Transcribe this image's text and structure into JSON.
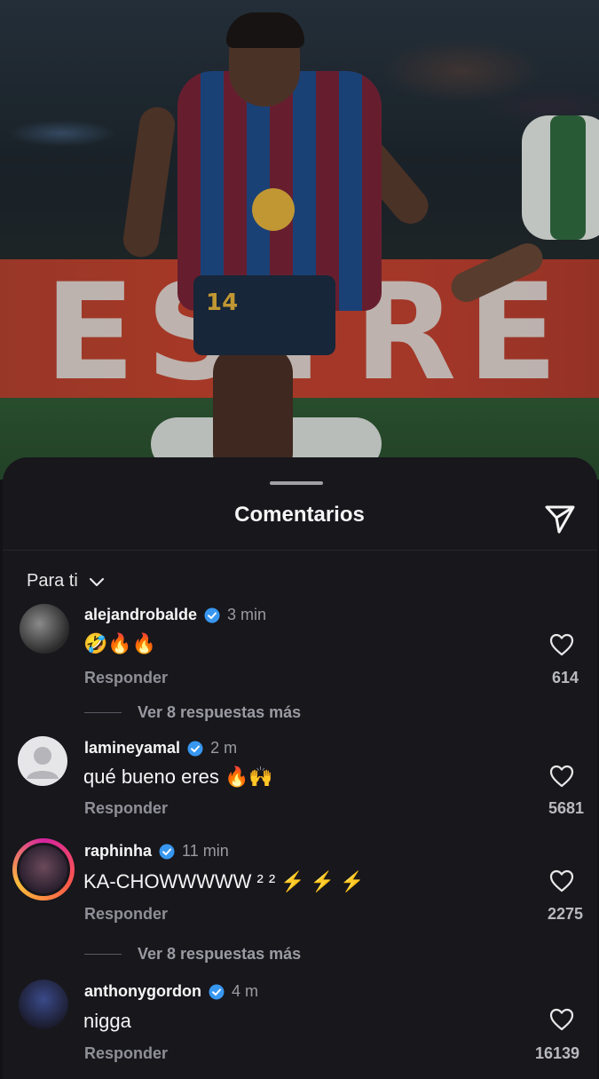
{
  "photo": {
    "banner_text": "ESTRE",
    "jersey_number": "14"
  },
  "sheet": {
    "title": "Comentarios",
    "filter_label": "Para ti"
  },
  "comments": [
    {
      "username": "alejandrobalde",
      "time": "3 min",
      "text": "🤣🔥🔥",
      "reply": "Responder",
      "likes": "614",
      "more_replies": "Ver 8 respuestas más"
    },
    {
      "username": "lamineyamal",
      "time": "2 m",
      "text": "qué bueno eres 🔥🙌",
      "reply": "Responder",
      "likes": "5681"
    },
    {
      "username": "raphinha",
      "time": "11 min",
      "text": "KA-CHOWWWWW ² ² ⚡ ⚡ ⚡",
      "reply": "Responder",
      "likes": "2275",
      "more_replies": "Ver 8 respuestas más"
    },
    {
      "username": "anthonygordon",
      "time": "4 m",
      "text": "nigga",
      "reply": "Responder",
      "likes": "16139"
    }
  ],
  "colors": {
    "sheet_bg": "#17171c",
    "verified": "#3897f0",
    "story_ring": "#d6249f"
  }
}
